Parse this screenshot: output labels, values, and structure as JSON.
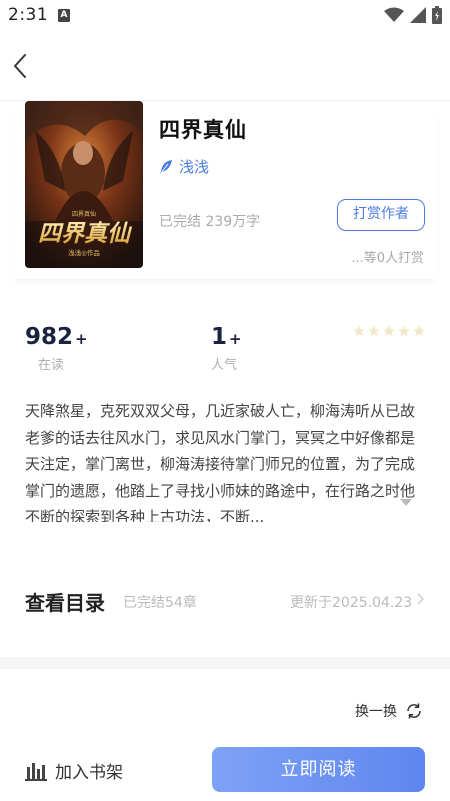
{
  "status_bar": {
    "time": "2:31",
    "app_icon_letter": "A"
  },
  "book": {
    "title": "四界真仙",
    "author": "浅浅",
    "meta": "已完结 239万字",
    "reward_label": "打赏作者",
    "reward_count": "...等0人打赏",
    "cover": {
      "top_text": "四界真仙",
      "main_text": "四界真仙",
      "author_text": "浅浅◎作品",
      "colors": {
        "bg_dark": "#2a1a14",
        "fire": "#c85a1e",
        "gold": "#e8c26a"
      }
    }
  },
  "stats": [
    {
      "value": "982",
      "suffix": "+",
      "label": "在读"
    },
    {
      "value": "1",
      "suffix": "+",
      "label": "人气"
    }
  ],
  "rating": {
    "stars": 5,
    "filled": 0
  },
  "synopsis": "天降煞星，克死双双父母，几近家破人亡，柳海涛听从已故老爹的话去往风水门，求见风水门掌门，冥冥之中好像都是天注定，掌门离世，柳海涛接待掌门师兄的位置，为了完成掌门的遗愿，他踏上了寻找小师妹的路途中，在行路之时他不断的探索到各种上古功法，不断...",
  "catalog": {
    "title": "查看目录",
    "status": "已完结54章",
    "update": "更新于2025.04.23"
  },
  "refresh_label": "换一换",
  "bottom": {
    "bookshelf_label": "加入书架",
    "read_label": "立即阅读"
  },
  "colors": {
    "accent": "#4f7ce0",
    "read_button": "#6b8ff2",
    "star": "#f3e9c9"
  },
  "icons": [
    "back-arrow-icon",
    "wifi-icon",
    "signal-icon",
    "battery-icon",
    "feather-icon",
    "star-icon",
    "chevron-right-icon",
    "refresh-icon",
    "bookshelf-icon"
  ]
}
